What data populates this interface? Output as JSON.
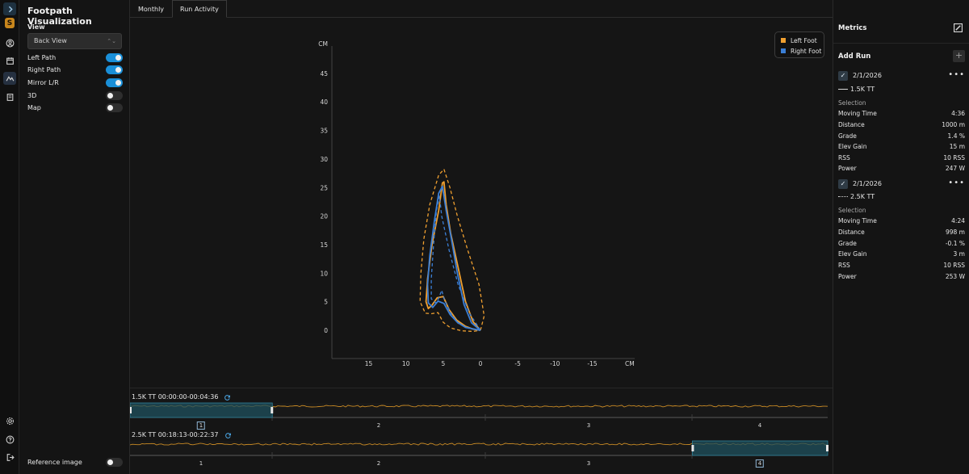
{
  "app": {
    "title": "Footpath Visualization"
  },
  "rail": {
    "icons": [
      "chevron-right-icon",
      "logo-s-icon",
      "profile-icon",
      "calendar-icon",
      "activity-icon",
      "notes-icon",
      "settings-icon",
      "help-icon",
      "logout-icon"
    ],
    "logo_letter": "S"
  },
  "sidebar": {
    "view_label": "View",
    "view_value": "Back View",
    "toggles": [
      {
        "label": "Left Path",
        "on": true
      },
      {
        "label": "Right Path",
        "on": true
      },
      {
        "label": "Mirror L/R",
        "on": true
      },
      {
        "label": "3D",
        "on": false
      },
      {
        "label": "Map",
        "on": false
      }
    ],
    "reference_image": {
      "label": "Reference image",
      "on": false
    }
  },
  "tabs": [
    {
      "label": "Monthly",
      "active": false
    },
    {
      "label": "Run Activity",
      "active": true
    }
  ],
  "chart_data": {
    "type": "line",
    "ylabel": "CM",
    "xlabel": "CM",
    "xticks": [
      15,
      10,
      5,
      0,
      -5,
      -10,
      -15
    ],
    "yticks": [
      0,
      5,
      10,
      15,
      20,
      25,
      30,
      35,
      40,
      45
    ],
    "xlim": [
      20,
      -20
    ],
    "ylim": [
      -4,
      48
    ],
    "legend_position": "top-right",
    "series": [
      {
        "name": "Left Foot",
        "color": "#f0a030",
        "paths": [
          {
            "style": "solid",
            "points": [
              [
                0,
                0
              ],
              [
                1,
                1.5
              ],
              [
                2,
                5
              ],
              [
                3,
                11
              ],
              [
                4,
                17
              ],
              [
                4.6,
                22
              ],
              [
                4.9,
                26
              ],
              [
                5.1,
                25.8
              ],
              [
                5.6,
                21
              ],
              [
                6.5,
                15
              ],
              [
                7.1,
                9
              ],
              [
                7.3,
                5
              ],
              [
                7,
                3.8
              ],
              [
                6.5,
                4.4
              ],
              [
                5.8,
                5.7
              ],
              [
                5,
                5.9
              ],
              [
                4.2,
                3.6
              ],
              [
                3.2,
                1.8
              ],
              [
                2,
                0.7
              ],
              [
                1,
                0.2
              ],
              [
                0,
                0
              ]
            ]
          },
          {
            "style": "dashed",
            "points": [
              [
                0,
                0
              ],
              [
                -0.5,
                2.5
              ],
              [
                0.2,
                8
              ],
              [
                1.7,
                14
              ],
              [
                3.1,
                20
              ],
              [
                4.1,
                25
              ],
              [
                4.9,
                28.2
              ],
              [
                5.6,
                27.2
              ],
              [
                6.8,
                22
              ],
              [
                7.6,
                16
              ],
              [
                8,
                10
              ],
              [
                8.1,
                5
              ],
              [
                7.4,
                3
              ],
              [
                6.6,
                2.9
              ],
              [
                5.7,
                3.1
              ],
              [
                5,
                1.4
              ],
              [
                4,
                0.4
              ],
              [
                2.5,
                -0.1
              ],
              [
                1,
                -0.2
              ],
              [
                0,
                0
              ]
            ]
          }
        ]
      },
      {
        "name": "Right Foot",
        "color": "#3b7fd6",
        "paths": [
          {
            "style": "solid",
            "points": [
              [
                0,
                0
              ],
              [
                1.2,
                1.3
              ],
              [
                2.2,
                4.5
              ],
              [
                3.1,
                10
              ],
              [
                3.9,
                16
              ],
              [
                4.6,
                21
              ],
              [
                5.1,
                25.2
              ],
              [
                5.6,
                24
              ],
              [
                6.2,
                19
              ],
              [
                6.8,
                13
              ],
              [
                7.1,
                8
              ],
              [
                7,
                4.8
              ],
              [
                6.4,
                4
              ],
              [
                5.7,
                5.1
              ],
              [
                4.9,
                4.7
              ],
              [
                4.1,
                2.8
              ],
              [
                3.1,
                1.4
              ],
              [
                2,
                0.5
              ],
              [
                0,
                0
              ]
            ]
          },
          {
            "style": "dashed",
            "points": [
              [
                0,
                0
              ],
              [
                1.5,
                3
              ],
              [
                3,
                8
              ],
              [
                4.2,
                14
              ],
              [
                5.2,
                20
              ],
              [
                5.5,
                23.5
              ],
              [
                5.9,
                21
              ],
              [
                6.3,
                15
              ],
              [
                6.6,
                9
              ],
              [
                6.6,
                5.5
              ],
              [
                6,
                4.8
              ],
              [
                5.6,
                5.6
              ],
              [
                5.2,
                7
              ],
              [
                4.8,
                5.2
              ],
              [
                4,
                3
              ],
              [
                3,
                1.2
              ],
              [
                1.5,
                0.3
              ],
              [
                0,
                0
              ]
            ]
          }
        ]
      }
    ]
  },
  "timelines": [
    {
      "title": "1.5K TT 00:00:00-00:04:36",
      "laps": [
        {
          "label": "1",
          "boxed": true
        },
        {
          "label": "2",
          "boxed": false
        },
        {
          "label": "3",
          "boxed": false
        },
        {
          "label": "4",
          "boxed": false
        }
      ],
      "selection": [
        0,
        0.204
      ]
    },
    {
      "title": "2.5K TT 00:18:13-00:22:37",
      "laps": [
        {
          "label": "1",
          "boxed": false
        },
        {
          "label": "2",
          "boxed": false
        },
        {
          "label": "3",
          "boxed": false
        },
        {
          "label": "4",
          "boxed": true
        }
      ],
      "selection": [
        0.806,
        1.0
      ]
    }
  ],
  "metrics": {
    "title": "Metrics",
    "add_run_label": "Add Run",
    "add_symbol": "+",
    "check_symbol": "✓",
    "more_symbol": "•••",
    "runs": [
      {
        "date": "2/1/2026",
        "name": "1.5K TT",
        "line_style": "solid",
        "selection_label": "Selection",
        "rows": [
          {
            "k": "Moving Time",
            "v": "4:36"
          },
          {
            "k": "Distance",
            "v": "1000 m"
          },
          {
            "k": "Grade",
            "v": "1.4 %"
          },
          {
            "k": "Elev Gain",
            "v": "15 m"
          },
          {
            "k": "RSS",
            "v": "10 RSS"
          },
          {
            "k": "Power",
            "v": "247 W"
          }
        ]
      },
      {
        "date": "2/1/2026",
        "name": "2.5K TT",
        "line_style": "dotted",
        "selection_label": "Selection",
        "rows": [
          {
            "k": "Moving Time",
            "v": "4:24"
          },
          {
            "k": "Distance",
            "v": "998 m"
          },
          {
            "k": "Grade",
            "v": "-0.1 %"
          },
          {
            "k": "Elev Gain",
            "v": "3 m"
          },
          {
            "k": "RSS",
            "v": "10 RSS"
          },
          {
            "k": "Power",
            "v": "253 W"
          }
        ]
      }
    ]
  }
}
